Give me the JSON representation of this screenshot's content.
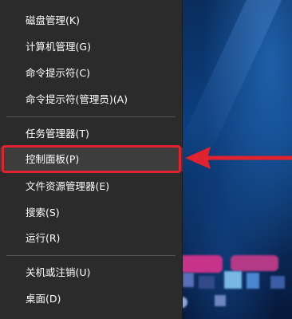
{
  "menu": {
    "items": [
      {
        "label": "磁盘管理(K)"
      },
      {
        "label": "计算机管理(G)"
      },
      {
        "label": "命令提示符(C)"
      },
      {
        "label": "命令提示符(管理员)(A)"
      },
      {
        "label": "任务管理器(T)"
      },
      {
        "label": "控制面板(P)"
      },
      {
        "label": "文件资源管理器(E)"
      },
      {
        "label": "搜索(S)"
      },
      {
        "label": "运行(R)"
      },
      {
        "label": "关机或注销(U)"
      },
      {
        "label": "桌面(D)"
      }
    ],
    "highlighted_item": "控制面板(P)"
  },
  "annotation": {
    "highlight_color": "#e0232e",
    "arrow_icon": "arrow-left-icon"
  },
  "colors": {
    "menu_bg": "#2b2b2b",
    "menu_text": "#ffffff",
    "separator": "#555555",
    "highlight_bg": "#3d3d3d"
  }
}
